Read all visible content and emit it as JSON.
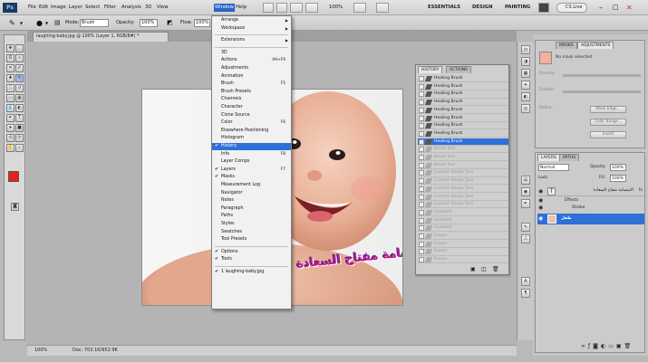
{
  "menubar": {
    "logo": "Ps",
    "items": [
      "File",
      "Edit",
      "Image",
      "Layer",
      "Select",
      "Filter",
      "Analysis",
      "3D",
      "View",
      "Window",
      "Help"
    ],
    "zoom": "100%",
    "workspaces": [
      "ESSENTIALS",
      "DESIGN",
      "PAINTING"
    ],
    "cslive": "CS Live"
  },
  "options": {
    "mode_label": "Mode:",
    "mode_value": "Brush",
    "opacity_label": "Opacity:",
    "opacity_value": "100%",
    "flow_label": "Flow:",
    "flow_value": "100%"
  },
  "document": {
    "tab_title": "laughing-baby.jpg @ 100% (Layer 1, RGB/8#) *",
    "status_zoom": "100%",
    "status_doc": "Doc: 703.1K/952.9K"
  },
  "window_menu": {
    "items": [
      {
        "label": "Arrange",
        "submenu": true
      },
      {
        "label": "Workspace",
        "submenu": true
      },
      {
        "sep": true
      },
      {
        "label": "Extensions",
        "submenu": true
      },
      {
        "sep": true
      },
      {
        "label": "3D"
      },
      {
        "label": "Actions",
        "shortcut": "Alt+F9"
      },
      {
        "label": "Adjustments"
      },
      {
        "label": "Animation"
      },
      {
        "label": "Brush",
        "shortcut": "F5"
      },
      {
        "label": "Brush Presets"
      },
      {
        "label": "Channels"
      },
      {
        "label": "Character"
      },
      {
        "label": "Clone Source"
      },
      {
        "label": "Color",
        "shortcut": "F6"
      },
      {
        "label": "Elsewhere Positioning"
      },
      {
        "label": "Histogram"
      },
      {
        "label": "History",
        "checked": true,
        "selected": true
      },
      {
        "label": "Info",
        "shortcut": "F8"
      },
      {
        "label": "Layer Comps"
      },
      {
        "label": "Layers",
        "shortcut": "F7",
        "checked": true
      },
      {
        "label": "Masks",
        "checked": true
      },
      {
        "label": "Measurement Log"
      },
      {
        "label": "Navigator"
      },
      {
        "label": "Notes"
      },
      {
        "label": "Paragraph"
      },
      {
        "label": "Paths"
      },
      {
        "label": "Styles"
      },
      {
        "label": "Swatches"
      },
      {
        "label": "Tool Presets"
      },
      {
        "sep": true
      },
      {
        "label": "Options",
        "checked": true
      },
      {
        "label": "Tools",
        "checked": true
      },
      {
        "sep": true
      },
      {
        "label": "1 laughing-baby.jpg",
        "checked": true
      }
    ]
  },
  "history": {
    "tabs": [
      "HISTORY",
      "ACTIONS"
    ],
    "rows": [
      {
        "label": "Healing Brush",
        "state": "normal"
      },
      {
        "label": "Healing Brush",
        "state": "normal"
      },
      {
        "label": "Healing Brush",
        "state": "normal"
      },
      {
        "label": "Healing Brush",
        "state": "normal"
      },
      {
        "label": "Healing Brush",
        "state": "normal"
      },
      {
        "label": "Healing Brush",
        "state": "normal"
      },
      {
        "label": "Healing Brush",
        "state": "normal"
      },
      {
        "label": "Healing Brush",
        "state": "normal"
      },
      {
        "label": "Healing Brush",
        "state": "active"
      },
      {
        "label": "Brush Tool",
        "state": "grey"
      },
      {
        "label": "Brush Tool",
        "state": "grey"
      },
      {
        "label": "Brush Tool",
        "state": "grey"
      },
      {
        "label": "Custom Shape Tool",
        "state": "grey"
      },
      {
        "label": "Custom Shape Tool",
        "state": "grey"
      },
      {
        "label": "Custom Shape Tool",
        "state": "grey"
      },
      {
        "label": "Custom Shape Tool",
        "state": "grey"
      },
      {
        "label": "Custom Shape Tool",
        "state": "grey"
      },
      {
        "label": "Gradient",
        "state": "grey"
      },
      {
        "label": "Gradient",
        "state": "grey"
      },
      {
        "label": "Gradient",
        "state": "grey"
      },
      {
        "label": "Eraser",
        "state": "grey"
      },
      {
        "label": "Eraser",
        "state": "grey"
      },
      {
        "label": "Eraser",
        "state": "grey"
      },
      {
        "label": "Eraser",
        "state": "grey"
      }
    ]
  },
  "masks": {
    "tabs": [
      "MASKS",
      "ADJUSTMENTS"
    ],
    "no_mask": "No mask selected",
    "density": "Density:",
    "feather": "Feather:",
    "refine": "Refine:",
    "mask_edge": "Mask Edge...",
    "color_range": "Color Range...",
    "invert": "Invert"
  },
  "layers": {
    "tabs": [
      "LAYERS",
      "PATHS"
    ],
    "blend_mode": "Normal",
    "opacity_label": "Opacity:",
    "opacity_value": "100%",
    "lock_label": "Lock:",
    "fill_label": "Fill:",
    "fill_value": "100%",
    "rows": [
      {
        "label": "الابتسامة مفتاح السعادة",
        "type": "text"
      },
      {
        "label": "Effects",
        "type": "effects"
      },
      {
        "label": "Stroke",
        "type": "effect"
      },
      {
        "label": "طفل",
        "type": "image",
        "selected": true
      }
    ]
  },
  "canvas_text": "الابتسامة مفتاح السعادة",
  "colors": {
    "foreground": "#e8201c",
    "background": "#ffffff",
    "selection": "#2e6fd8",
    "text_pink": "#c2188a"
  }
}
